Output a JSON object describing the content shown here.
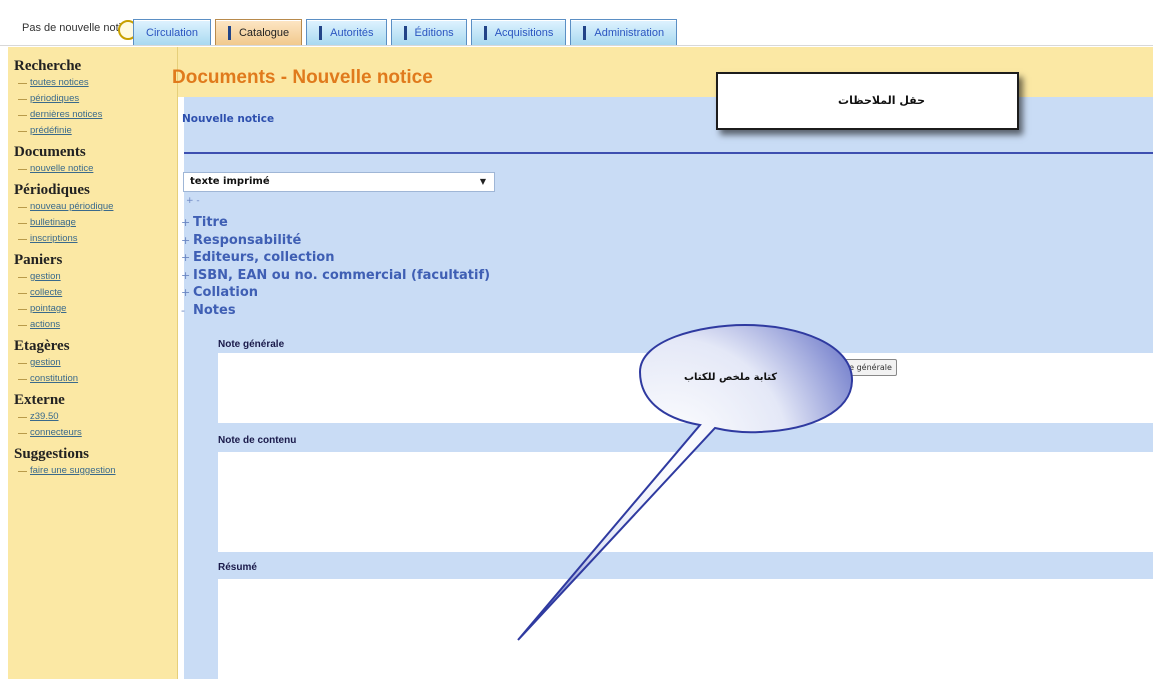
{
  "notification": "Pas de nouvelle notification",
  "tabs": [
    {
      "label": "Circulation",
      "active": false
    },
    {
      "label": "Catalogue",
      "active": true
    },
    {
      "label": "Autorités",
      "active": false
    },
    {
      "label": "Éditions",
      "active": false
    },
    {
      "label": "Acquisitions",
      "active": false
    },
    {
      "label": "Administration",
      "active": false
    }
  ],
  "sidebar": {
    "sections": [
      {
        "title": "Recherche",
        "links": [
          "toutes notices",
          "périodiques",
          "dernières notices",
          "prédéfinie"
        ]
      },
      {
        "title": "Documents",
        "links": [
          "nouvelle notice"
        ]
      },
      {
        "title": "Périodiques",
        "links": [
          "nouveau périodique",
          "bulletinage",
          "inscriptions"
        ]
      },
      {
        "title": "Paniers",
        "links": [
          "gestion",
          "collecte",
          "pointage",
          "actions"
        ]
      },
      {
        "title": "Etagères",
        "links": [
          "gestion",
          "constitution"
        ]
      },
      {
        "title": "Externe",
        "links": [
          "z39.50",
          "connecteurs"
        ]
      },
      {
        "title": "Suggestions",
        "links": [
          "faire une suggestion"
        ]
      }
    ]
  },
  "main": {
    "page_title": "Documents - Nouvelle notice",
    "panel_title": "Nouvelle notice",
    "doc_type_select": "texte imprimé",
    "expand_collapse": "+ -",
    "tree": [
      {
        "sign": "+",
        "label": "Titre"
      },
      {
        "sign": "+",
        "label": "Responsabilité"
      },
      {
        "sign": "+",
        "label": "Editeurs, collection"
      },
      {
        "sign": "+",
        "label": "ISBN, EAN ou no. commercial (facultatif)"
      },
      {
        "sign": "+",
        "label": "Collation"
      },
      {
        "sign": "-",
        "label": "Notes"
      }
    ],
    "fields": {
      "note_generale": "Note générale",
      "note_contenu": "Note de contenu",
      "resume": "Résumé"
    },
    "note_button": "te générale"
  },
  "annotations": {
    "box_text": "حقل الملاحظات",
    "bubble_text": "كتابة ملخص للكتاب"
  },
  "colors": {
    "sidebar_bg": "#fbe8a4",
    "panel_bg": "#c9dcf5",
    "title_orange": "#e07a1c",
    "link_blue": "#3f5fb4"
  }
}
